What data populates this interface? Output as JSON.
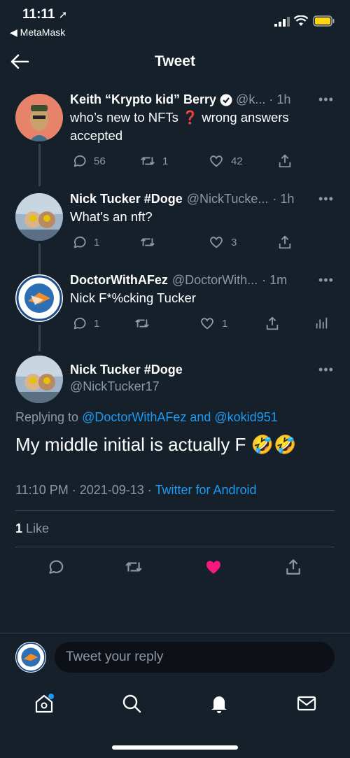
{
  "status_bar": {
    "time": "11:11",
    "back_app": "◀ MetaMask"
  },
  "header": {
    "title": "Tweet"
  },
  "tweets": [
    {
      "name": "Keith “Krypto kid” Berry",
      "handle": "@k...",
      "time": "· 1h",
      "text": "who’s new to NFTs ❓ wrong answers accepted",
      "replies": "56",
      "retweets": "1",
      "likes": "42"
    },
    {
      "name": "Nick Tucker #Doge",
      "handle": "@NickTucke...",
      "time": "· 1h",
      "text": "What's an nft?",
      "replies": "1",
      "retweets": "",
      "likes": "3"
    },
    {
      "name": "DoctorWithAFez",
      "handle": "@DoctorWith...",
      "time": "· 1m",
      "text": "Nick F*%cking Tucker",
      "replies": "1",
      "retweets": "",
      "likes": "1"
    }
  ],
  "main_tweet": {
    "name": "Nick Tucker #Doge",
    "handle": "@NickTucker17",
    "replying_prefix": "Replying to ",
    "replying_users": "@DoctorWithAFez and @kokid951",
    "text": "My middle initial is actually F 🤣🤣",
    "timestamp": "11:10 PM · 2021-09-13 · ",
    "source": "Twitter for Android",
    "like_count": "1",
    "like_label": " Like"
  },
  "reply": {
    "placeholder": "Tweet your reply"
  },
  "colors": {
    "background": "#15202b",
    "accent": "#1d9bf0",
    "like": "#f91880",
    "muted": "#8b98a5"
  }
}
